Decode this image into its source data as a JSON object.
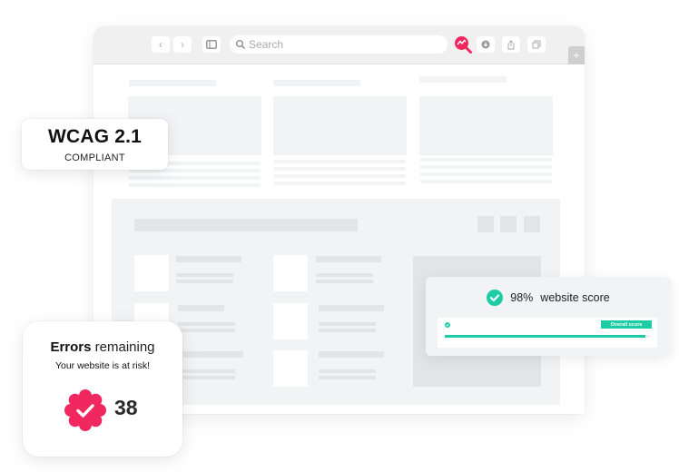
{
  "browser": {
    "search_placeholder": "Search",
    "toolbar_icons": [
      "back-icon",
      "forward-icon",
      "sidebar-icon",
      "search-icon",
      "accessibility-extension-icon",
      "download-icon",
      "share-icon",
      "tabs-icon",
      "new-tab-icon"
    ],
    "new_tab_label": "+"
  },
  "wcag_badge": {
    "title": "WCAG 2.1",
    "subtitle": "COMPLIANT"
  },
  "score_card": {
    "percent_label": "98%",
    "label": "website score",
    "badge_label": "Overall score",
    "progress_fraction": 0.98,
    "accent_color": "#1ccca5"
  },
  "errors_card": {
    "title_bold": "Errors",
    "title_rest": " remaining",
    "subtitle": "Your website is at risk!",
    "count": "38",
    "badge_color": "#f0285f"
  }
}
